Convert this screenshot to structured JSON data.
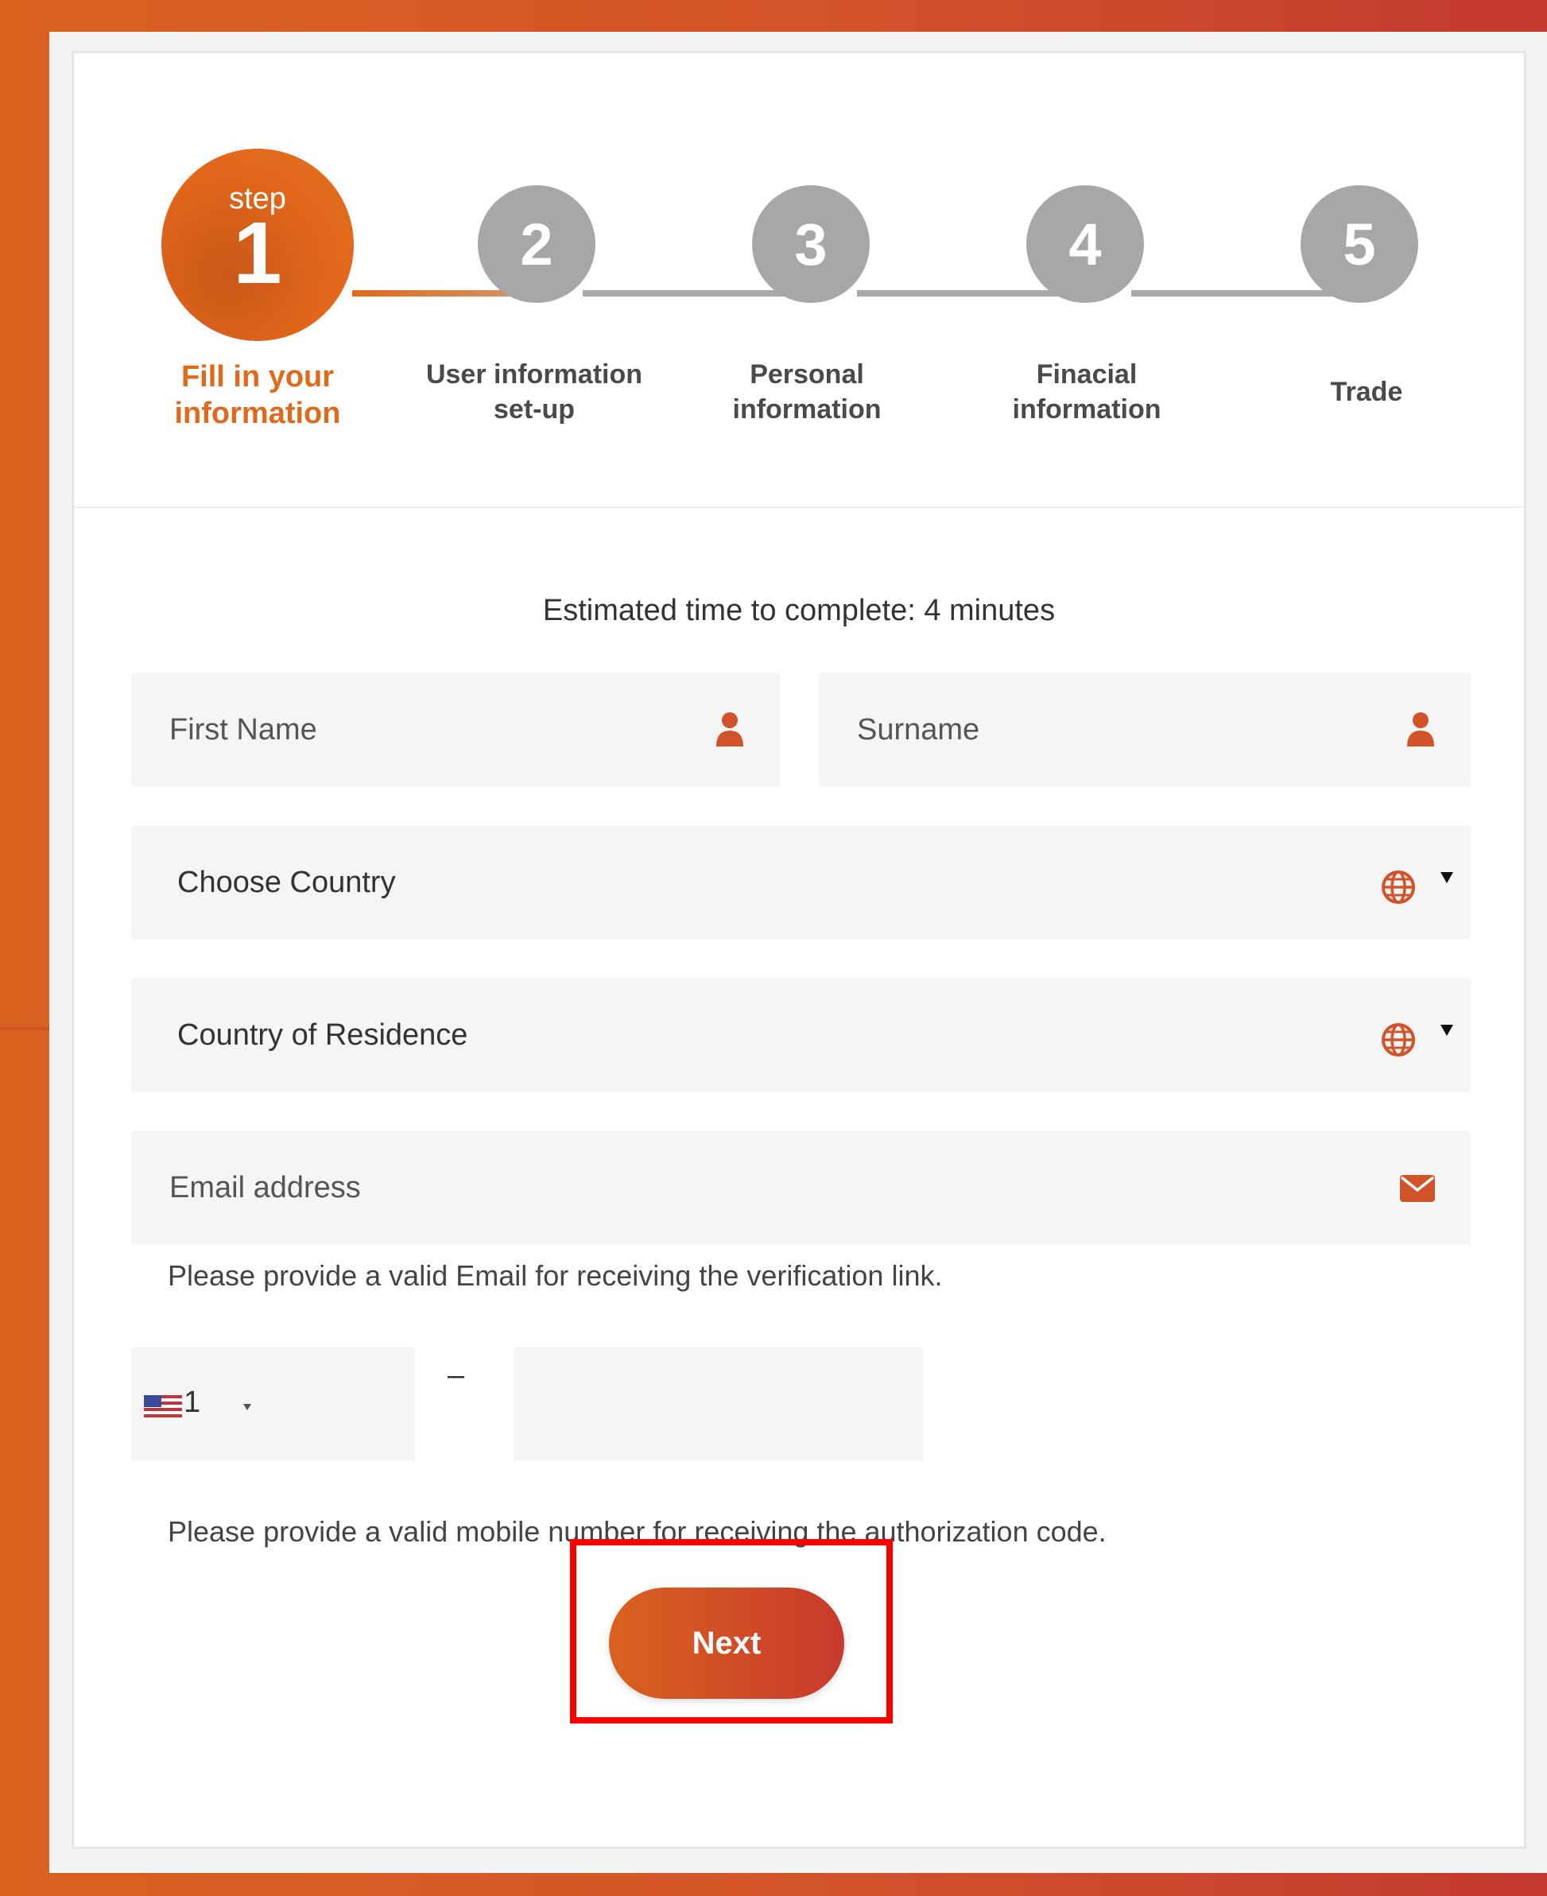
{
  "stepper": {
    "step_word": "step",
    "steps": [
      {
        "number": "1",
        "label_line1": "Fill in your",
        "label_line2": "information"
      },
      {
        "number": "2",
        "label_line1": "User information",
        "label_line2": "set-up"
      },
      {
        "number": "3",
        "label_line1": "Personal",
        "label_line2": "information"
      },
      {
        "number": "4",
        "label_line1": "Finacial",
        "label_line2": "information"
      },
      {
        "number": "5",
        "label_line1": "Trade",
        "label_line2": ""
      }
    ]
  },
  "form": {
    "estimate_text": "Estimated time to complete: 4 minutes",
    "first_name_placeholder": "First Name",
    "surname_placeholder": "Surname",
    "choose_country": "Choose Country",
    "country_of_residence": "Country of Residence",
    "email_placeholder": "Email address",
    "email_hint": "Please provide a valid Email for receiving the verification link.",
    "phone_code": "1",
    "phone_separator": "–",
    "phone_hint": "Please provide a valid mobile number for receiving the authorization code.",
    "next_label": "Next"
  },
  "icons": {
    "person": "person-icon",
    "globe": "globe-icon",
    "envelope": "envelope-icon",
    "dropdown": "caret-down-icon",
    "flag": "us-flag-icon"
  },
  "colors": {
    "accent": "#e06a1c",
    "accent_dark": "#c83a2c",
    "step_inactive": "#a7a7a7",
    "highlight_outline": "#ff0000"
  }
}
